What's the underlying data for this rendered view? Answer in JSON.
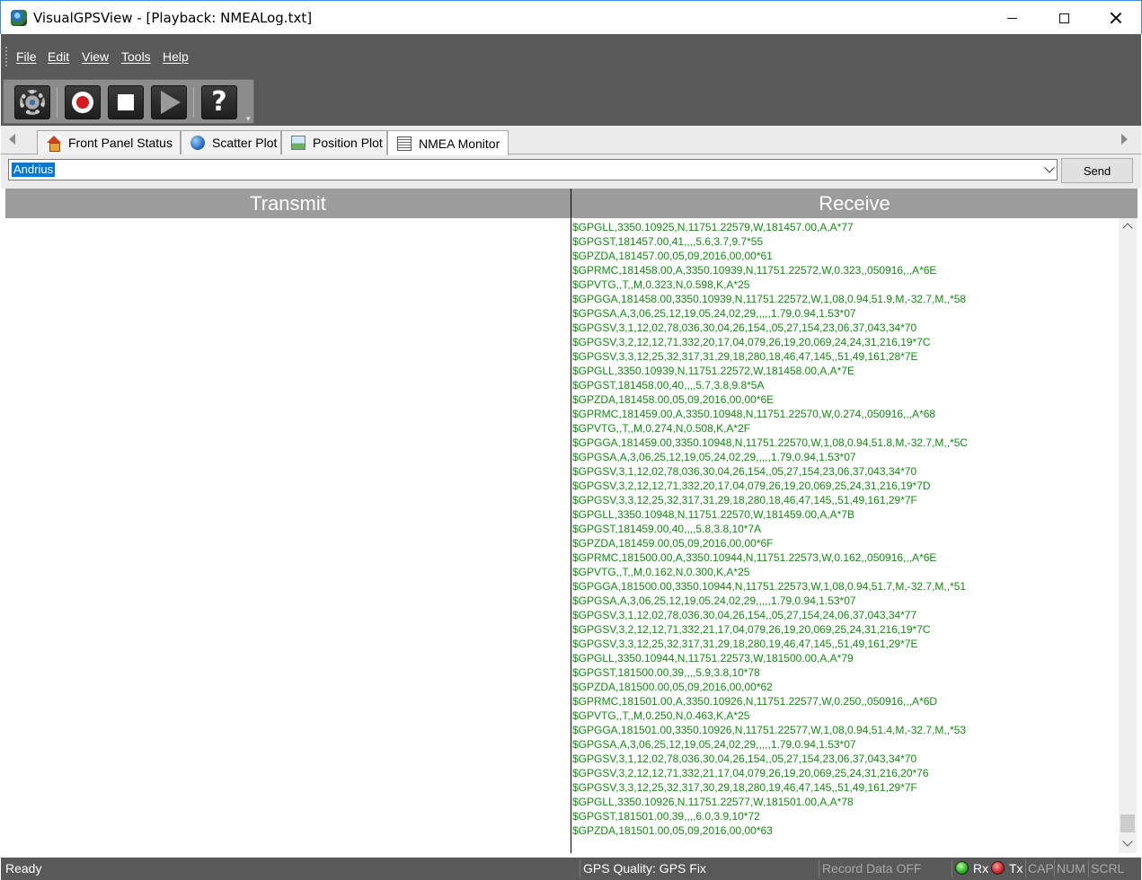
{
  "window": {
    "title": "VisualGPSView - [Playback: NMEALog.txt]"
  },
  "menu": [
    "File",
    "Edit",
    "View",
    "Tools",
    "Help"
  ],
  "toolbar": {
    "buttons": [
      "settings-gear-icon",
      "record-icon",
      "stop-icon",
      "play-icon",
      "help-icon"
    ]
  },
  "tabs": [
    {
      "label": "Front Panel Status",
      "icon": "home-icon"
    },
    {
      "label": "Scatter Plot",
      "icon": "globe-icon"
    },
    {
      "label": "Position Plot",
      "icon": "image-icon"
    },
    {
      "label": "NMEA Monitor",
      "icon": "monitor-icon",
      "active": true
    }
  ],
  "command": {
    "value": "Andrius",
    "send_label": "Send"
  },
  "panels": {
    "transmit_title": "Transmit",
    "receive_title": "Receive"
  },
  "receive_lines": [
    "$GPGLL,3350.10925,N,11751.22579,W,181457.00,A,A*77",
    "$GPGST,181457.00,41,,,,5.6,3.7,9.7*55",
    "$GPZDA,181457.00,05,09,2016,00,00*61",
    "$GPRMC,181458.00,A,3350.10939,N,11751.22572,W,0.323,,050916,,,A*6E",
    "$GPVTG,,T,,M,0.323,N,0.598,K,A*25",
    "$GPGGA,181458.00,3350.10939,N,11751.22572,W,1,08,0.94,51.9,M,-32.7,M,,*58",
    "$GPGSA,A,3,06,25,12,19,05,24,02,29,,,,,1.79,0.94,1.53*07",
    "$GPGSV,3,1,12,02,78,036,30,04,26,154,,05,27,154,23,06,37,043,34*70",
    "$GPGSV,3,2,12,12,71,332,20,17,04,079,26,19,20,069,24,24,31,216,19*7C",
    "$GPGSV,3,3,12,25,32,317,31,29,18,280,18,46,47,145,,51,49,161,28*7E",
    "$GPGLL,3350.10939,N,11751.22572,W,181458.00,A,A*7E",
    "$GPGST,181458.00,40,,,,5.7,3.8,9.8*5A",
    "$GPZDA,181458.00,05,09,2016,00,00*6E",
    "$GPRMC,181459.00,A,3350.10948,N,11751.22570,W,0.274,,050916,,,A*68",
    "$GPVTG,,T,,M,0.274,N,0.508,K,A*2F",
    "$GPGGA,181459.00,3350.10948,N,11751.22570,W,1,08,0.94,51.8,M,-32.7,M,,*5C",
    "$GPGSA,A,3,06,25,12,19,05,24,02,29,,,,,1.79,0.94,1.53*07",
    "$GPGSV,3,1,12,02,78,036,30,04,26,154,,05,27,154,23,06,37,043,34*70",
    "$GPGSV,3,2,12,12,71,332,20,17,04,079,26,19,20,069,25,24,31,216,19*7D",
    "$GPGSV,3,3,12,25,32,317,31,29,18,280,18,46,47,145,,51,49,161,29*7F",
    "$GPGLL,3350.10948,N,11751.22570,W,181459.00,A,A*7B",
    "$GPGST,181459.00,40,,,,5.8,3.8,10*7A",
    "$GPZDA,181459.00,05,09,2016,00,00*6F",
    "$GPRMC,181500.00,A,3350.10944,N,11751.22573,W,0.162,,050916,,,A*6E",
    "$GPVTG,,T,,M,0.162,N,0.300,K,A*25",
    "$GPGGA,181500.00,3350.10944,N,11751.22573,W,1,08,0.94,51.7,M,-32.7,M,,*51",
    "$GPGSA,A,3,06,25,12,19,05,24,02,29,,,,,1.79,0.94,1.53*07",
    "$GPGSV,3,1,12,02,78,036,30,04,26,154,,05,27,154,24,06,37,043,34*77",
    "$GPGSV,3,2,12,12,71,332,21,17,04,079,26,19,20,069,25,24,31,216,19*7C",
    "$GPGSV,3,3,12,25,32,317,31,29,18,280,19,46,47,145,,51,49,161,29*7E",
    "$GPGLL,3350.10944,N,11751.22573,W,181500.00,A,A*79",
    "$GPGST,181500.00,39,,,,5.9,3.8,10*78",
    "$GPZDA,181500.00,05,09,2016,00,00*62",
    "$GPRMC,181501.00,A,3350.10926,N,11751.22577,W,0.250,,050916,,,A*6D",
    "$GPVTG,,T,,M,0.250,N,0.463,K,A*25",
    "$GPGGA,181501.00,3350.10926,N,11751.22577,W,1,08,0.94,51.4,M,-32.7,M,,*53",
    "$GPGSA,A,3,06,25,12,19,05,24,02,29,,,,,1.79,0.94,1.53*07",
    "$GPGSV,3,1,12,02,78,036,30,04,26,154,,05,27,154,23,06,37,043,34*70",
    "$GPGSV,3,2,12,12,71,332,21,17,04,079,26,19,20,069,25,24,31,216,20*76",
    "$GPGSV,3,3,12,25,32,317,30,29,18,280,19,46,47,145,,51,49,161,29*7F",
    "$GPGLL,3350.10926,N,11751.22577,W,181501.00,A,A*78",
    "$GPGST,181501.00,39,,,,6.0,3.9,10*72",
    "$GPZDA,181501.00,05,09,2016,00,00*63"
  ],
  "status": {
    "ready": "Ready",
    "gps_quality": "GPS Quality: GPS Fix",
    "record": "Record Data OFF",
    "rx": "Rx",
    "tx": "Tx",
    "cap": "CAP",
    "num": "NUM",
    "scrl": "SCRL"
  },
  "colors": {
    "receive_text": "#119010",
    "chrome_dark": "#595959",
    "panel_header": "#9c9c9c",
    "selection": "#0078d7",
    "rx_led": "#14a014",
    "tx_led": "#c01414"
  }
}
